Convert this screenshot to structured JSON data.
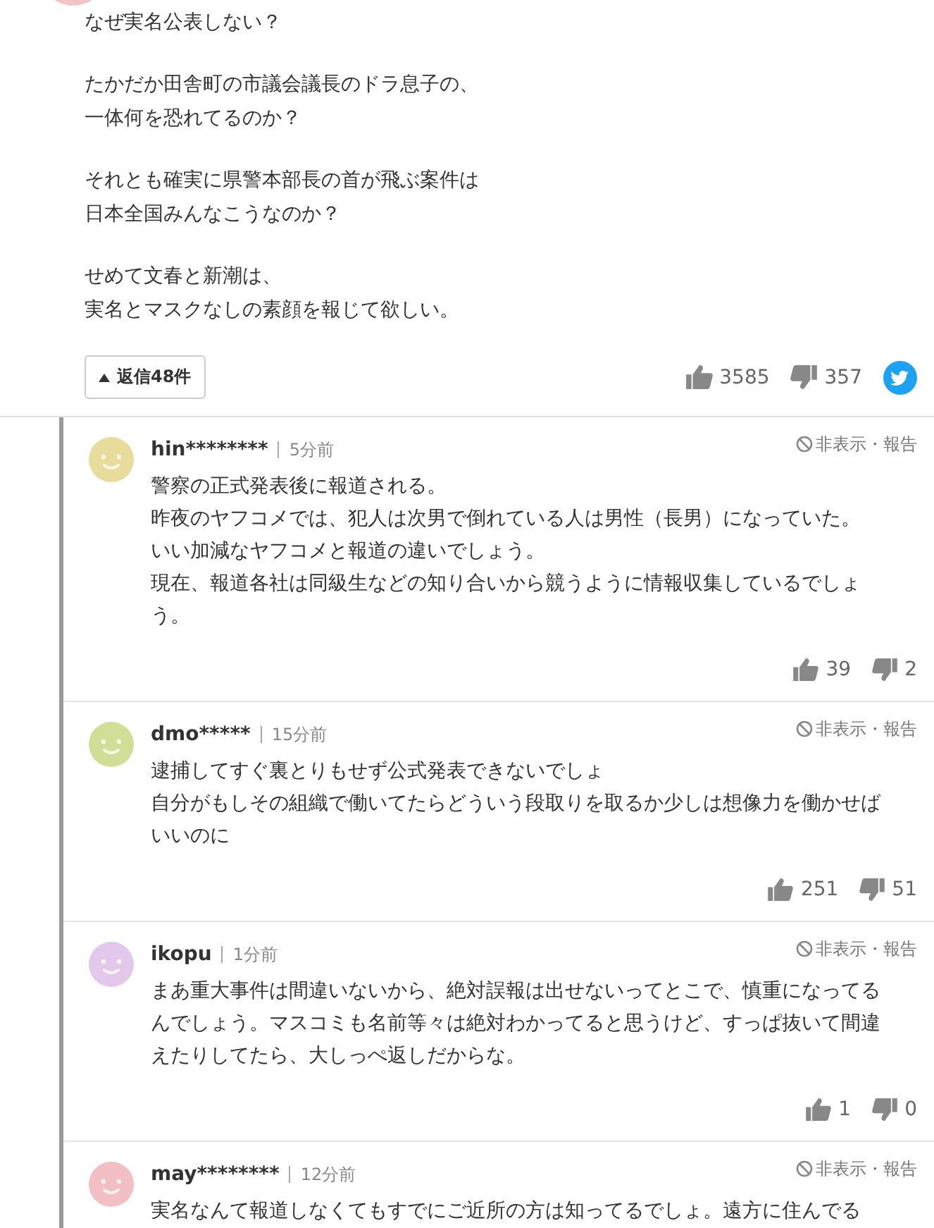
{
  "comment": {
    "color": "#f2c4c4",
    "paragraphs": [
      [
        "なぜ実名公表しない？"
      ],
      [
        "たかだか田舎町の市議会議長のドラ息子の、",
        "一体何を恐れてるのか？"
      ],
      [
        "それとも確実に県警本部長の首が飛ぶ案件は",
        "日本全国みんなこうなのか？"
      ],
      [
        "せめて文春と新潮は、",
        "実名とマスクなしの素顔を報じて欲しい。"
      ]
    ],
    "reply_button": "返信48件",
    "likes": "3585",
    "dislikes": "357"
  },
  "replies": [
    {
      "user": "hin********",
      "time": "5分前",
      "color": "#e8dc9c",
      "actions": "非表示・報告",
      "lines": [
        "警察の正式発表後に報道される。",
        "昨夜のヤフコメでは、犯人は次男で倒れている人は男性（長男）になっていた。",
        "いい加減なヤフコメと報道の違いでしょう。",
        "現在、報道各社は同級生などの知り合いから競うように情報収集しているでしょう。"
      ],
      "likes": "39",
      "dislikes": "2"
    },
    {
      "user": "dmo*****",
      "time": "15分前",
      "color": "#cfdf96",
      "actions": "非表示・報告",
      "lines": [
        "逮捕してすぐ裏とりもせず公式発表できないでしょ",
        "自分がもしその組織で働いてたらどういう段取りを取るか少しは想像力を働かせばいいのに"
      ],
      "likes": "251",
      "dislikes": "51"
    },
    {
      "user": "ikopu",
      "time": "1分前",
      "color": "#e3c8ec",
      "actions": "非表示・報告",
      "lines": [
        "まあ重大事件は間違いないから、絶対誤報は出せないってとこで、慎重になってるんでしょう。マスコミも名前等々は絶対わかってると思うけど、すっぱ抜いて間違えたりしてたら、大しっぺ返しだからな。"
      ],
      "likes": "1",
      "dislikes": "0"
    },
    {
      "user": "may********",
      "time": "12分前",
      "color": "#f2c0c4",
      "actions": "非表示・報告",
      "lines": [
        "実名なんて報道しなくてもすでにご近所の方は知ってるでしょ。遠方に住んでる"
      ]
    }
  ]
}
